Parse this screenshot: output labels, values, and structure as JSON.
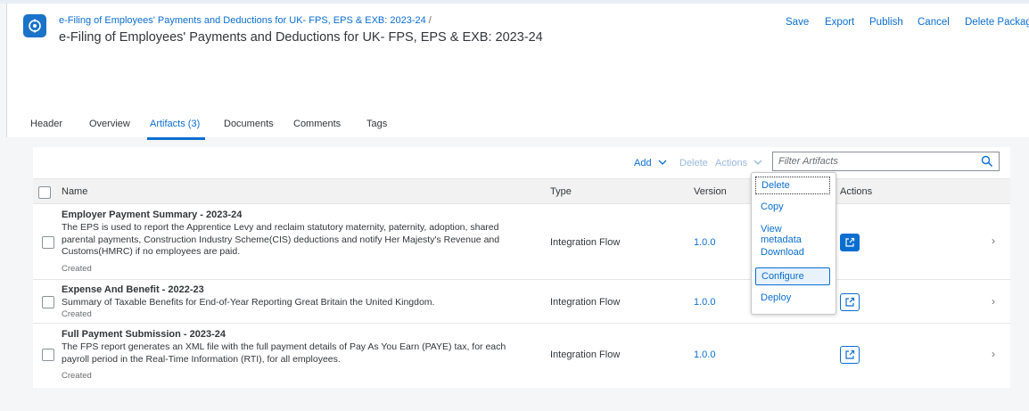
{
  "header": {
    "breadcrumb": "e-Filing of Employees' Payments and Deductions for UK- FPS, EPS & EXB: 2023-24",
    "breadcrumb_separator": "/",
    "title": "e-Filing of Employees' Payments and Deductions for UK- FPS, EPS & EXB: 2023-24",
    "app_icon": "package-icon",
    "actions": {
      "save": "Save",
      "export": "Export",
      "publish": "Publish",
      "cancel": "Cancel",
      "delete_package": "Delete Package"
    }
  },
  "tabs": [
    {
      "label": "Header"
    },
    {
      "label": "Overview"
    },
    {
      "label": "Artifacts (3)",
      "selected": true
    },
    {
      "label": "Documents"
    },
    {
      "label": "Comments"
    },
    {
      "label": "Tags"
    }
  ],
  "toolbar": {
    "add": "Add",
    "delete": "Delete",
    "actions": "Actions",
    "filter_placeholder": "Filter Artifacts"
  },
  "table": {
    "columns": {
      "name": "Name",
      "type": "Type",
      "version": "Version",
      "actions": "Actions"
    },
    "rows": [
      {
        "title": "Employer Payment Summary - 2023-24",
        "description": "The EPS is used to report the Apprentice Levy and reclaim statutory maternity, paternity, adoption, shared parental payments, Construction Industry Scheme(CIS) deductions and notify Her Majesty's Revenue and Customs(HMRC) if no employees are paid.",
        "status": "Created",
        "type": "Integration Flow",
        "version": "1.0.0"
      },
      {
        "title": "Expense And Benefit - 2022-23",
        "description": "Summary of Taxable Benefits for End-of-Year Reporting Great Britain the United Kingdom.",
        "status": "Created",
        "type": "Integration Flow",
        "version": "1.0.0"
      },
      {
        "title": "Full Payment Submission - 2023-24",
        "description": "The FPS report generates an XML file with the full payment details of Pay As You Earn (PAYE) tax, for each payroll period in the Real-Time Information (RTI), for all employees.",
        "status": "Created",
        "type": "Integration Flow",
        "version": "1.0.0"
      }
    ]
  },
  "actions_menu": {
    "items": [
      "Delete",
      "Copy",
      "View metadata",
      "Download",
      "Configure",
      "Deploy"
    ],
    "focused": "Delete",
    "highlighted": "Configure"
  },
  "colors": {
    "accent": "#0a6ed1",
    "text": "#32363a",
    "background": "#f5f6f7"
  }
}
